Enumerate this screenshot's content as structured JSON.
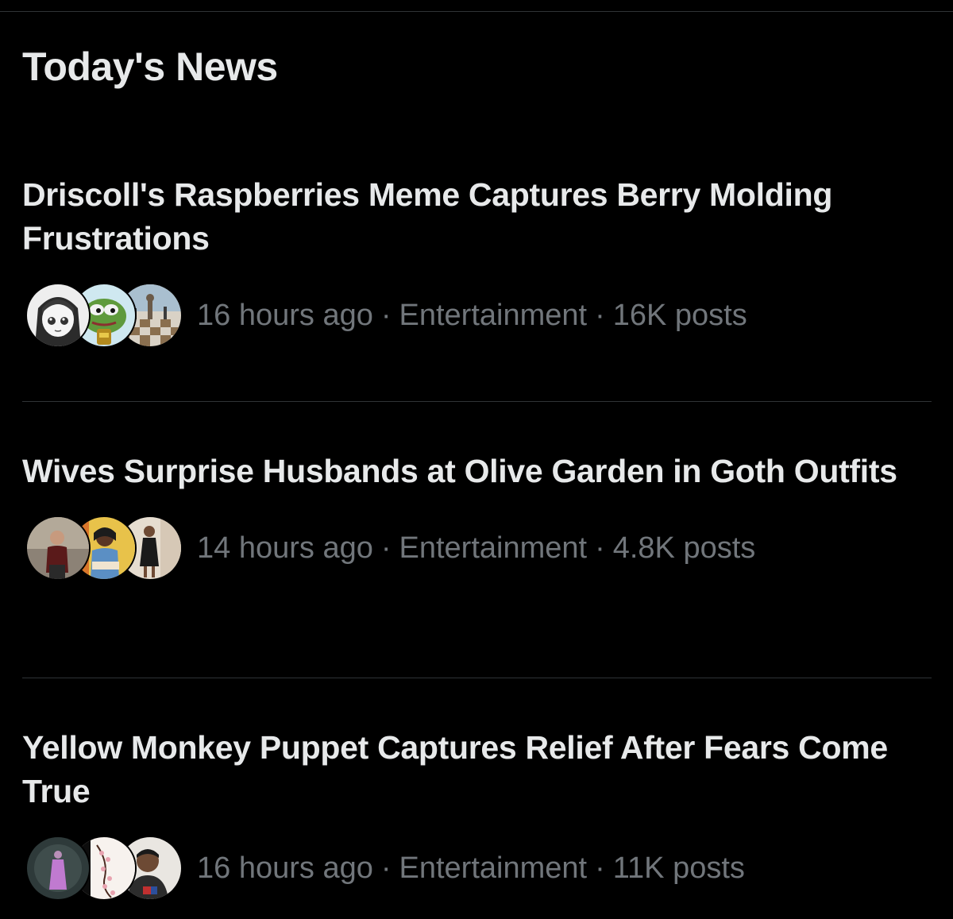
{
  "section": {
    "title": "Today's News"
  },
  "separator": "·",
  "news": [
    {
      "headline": "Driscoll's Raspberries Meme Captures Berry Molding Frustrations",
      "time": "16 hours ago",
      "category": "Entertainment",
      "posts": "16K posts",
      "avatars": [
        "anime-girl-avatar",
        "pepe-frog-avatar",
        "chess-scene-avatar"
      ]
    },
    {
      "headline": "Wives Surprise Husbands at Olive Garden in Goth Outfits",
      "time": "14 hours ago",
      "category": "Entertainment",
      "posts": "4.8K posts",
      "avatars": [
        "selfie-woman-avatar",
        "woman-portrait-avatar",
        "woman-dress-avatar"
      ]
    },
    {
      "headline": "Yellow Monkey Puppet Captures Relief After Fears Come True",
      "time": "16 hours ago",
      "category": "Entertainment",
      "posts": "11K posts",
      "avatars": [
        "purple-figure-avatar",
        "cherry-blossom-avatar",
        "man-selfie-avatar"
      ]
    }
  ],
  "colors": {
    "background": "#000000",
    "text_primary": "#e7e9ea",
    "text_secondary": "#71767b",
    "divider": "#2f3336"
  }
}
